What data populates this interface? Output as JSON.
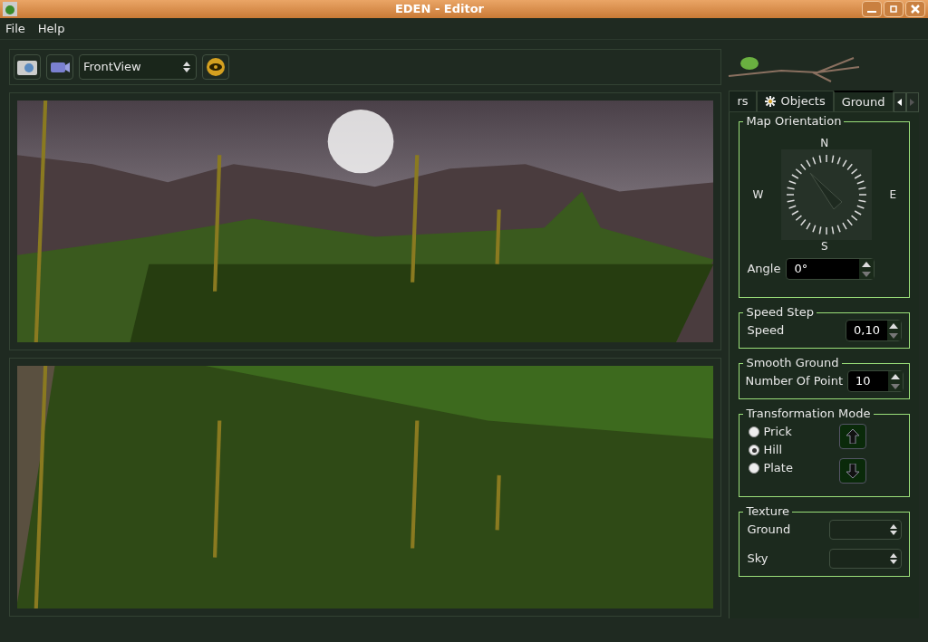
{
  "window": {
    "title": "EDEN - Editor"
  },
  "menu": [
    "File",
    "Help"
  ],
  "toolbar": {
    "view_select": "FrontView"
  },
  "tabs": [
    {
      "label": "rs",
      "selected": false,
      "kind": "plain"
    },
    {
      "label": "Objects",
      "selected": false,
      "kind": "icon"
    },
    {
      "label": "Ground",
      "selected": true,
      "kind": "plain"
    }
  ],
  "map_orientation": {
    "title": "Map Orientation",
    "north": "N",
    "west": "W",
    "east": "E",
    "south": "S",
    "angle_label": "Angle",
    "angle_value": "0°"
  },
  "speed_step": {
    "title": "Speed Step",
    "label": "Speed",
    "value": "0,10"
  },
  "smooth_ground": {
    "title": "Smooth Ground",
    "label": "Number Of Point",
    "value": "10"
  },
  "transformation_mode": {
    "title": "Transformation Mode",
    "options": [
      {
        "label": "Prick",
        "selected": false
      },
      {
        "label": "Hill",
        "selected": true
      },
      {
        "label": "Plate",
        "selected": false
      }
    ]
  },
  "texture": {
    "title": "Texture",
    "fields": [
      {
        "label": "Ground"
      },
      {
        "label": "Sky"
      }
    ]
  }
}
